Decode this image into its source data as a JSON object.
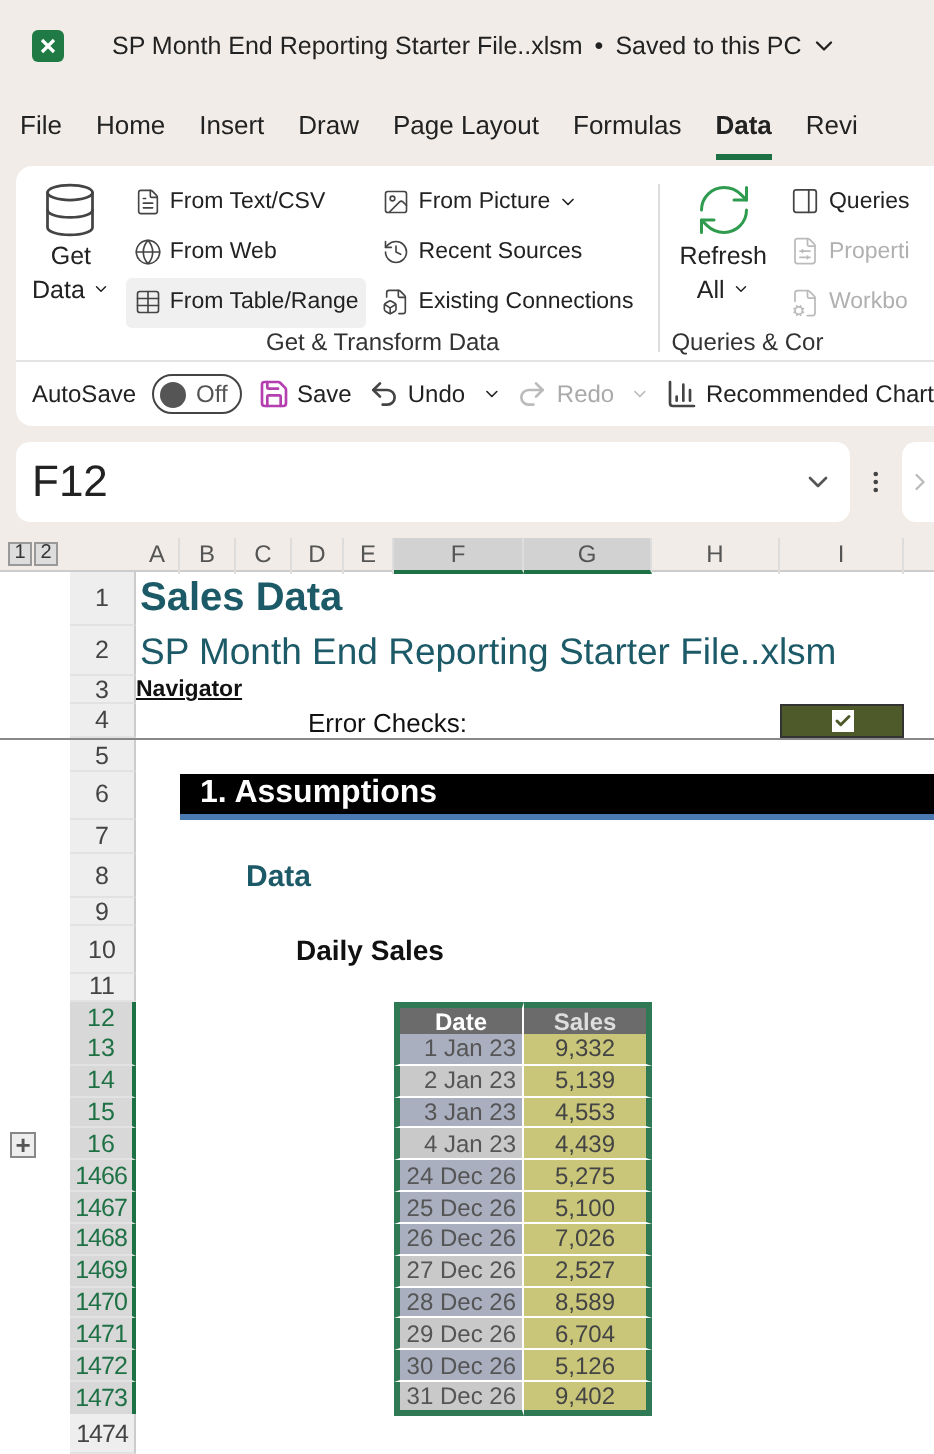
{
  "window": {
    "title": "SP Month End Reporting Starter File..xlsm",
    "separator": "•",
    "save_status": "Saved to this PC"
  },
  "tabs": [
    {
      "label": "File",
      "selected": false
    },
    {
      "label": "Home",
      "selected": false
    },
    {
      "label": "Insert",
      "selected": false
    },
    {
      "label": "Draw",
      "selected": false
    },
    {
      "label": "Page Layout",
      "selected": false
    },
    {
      "label": "Formulas",
      "selected": false
    },
    {
      "label": "Data",
      "selected": true
    },
    {
      "label": "Revi",
      "selected": false
    }
  ],
  "ribbon": {
    "get_transform": {
      "get_data": {
        "line1": "Get",
        "line2": "Data"
      },
      "items": [
        {
          "label": "From Text/CSV",
          "caret": false,
          "hovered": false
        },
        {
          "label": "From Web",
          "caret": false,
          "hovered": false
        },
        {
          "label": "From Table/Range",
          "caret": false,
          "hovered": true
        },
        {
          "label": "From Picture",
          "caret": true,
          "hovered": false
        },
        {
          "label": "Recent Sources",
          "caret": false,
          "hovered": false
        },
        {
          "label": "Existing Connections",
          "caret": false,
          "hovered": false
        }
      ],
      "group_label": "Get & Transform Data"
    },
    "queries": {
      "refresh": {
        "line1": "Refresh",
        "line2": "All"
      },
      "items": [
        {
          "label": "Queries",
          "disabled": false
        },
        {
          "label": "Properti",
          "disabled": true
        },
        {
          "label": "Workbo",
          "disabled": true
        }
      ],
      "group_label": "Queries & Cor"
    }
  },
  "quick_access": {
    "autosave_label": "AutoSave",
    "autosave_on": false,
    "autosave_state": "Off",
    "save": "Save",
    "undo": "Undo",
    "redo": "Redo",
    "redo_disabled": true,
    "recommended": "Recommended Chart"
  },
  "name_box": {
    "value": "F12"
  },
  "outline_levels": [
    "1",
    "2"
  ],
  "columns": [
    {
      "label": "A",
      "selected": false
    },
    {
      "label": "B",
      "selected": false
    },
    {
      "label": "C",
      "selected": false
    },
    {
      "label": "D",
      "selected": false
    },
    {
      "label": "E",
      "selected": false
    },
    {
      "label": "F",
      "selected": true
    },
    {
      "label": "G",
      "selected": true
    },
    {
      "label": "H",
      "selected": false
    },
    {
      "label": "I",
      "selected": false
    }
  ],
  "rows": [
    {
      "num": "1",
      "kind": "title",
      "text": "Sales Data",
      "selected": false
    },
    {
      "num": "2",
      "kind": "subtitle",
      "text": "SP Month End Reporting Starter File..xlsm",
      "selected": false
    },
    {
      "num": "3",
      "kind": "link",
      "text": "Navigator",
      "selected": false
    },
    {
      "num": "4",
      "kind": "check",
      "label": "Error Checks:",
      "checked": true,
      "selected": false
    },
    {
      "num": "5",
      "kind": "empty",
      "selected": false
    },
    {
      "num": "6",
      "kind": "section",
      "text": "1. Assumptions",
      "selected": false
    },
    {
      "num": "7",
      "kind": "empty",
      "selected": false
    },
    {
      "num": "8",
      "kind": "heading",
      "text": "Data",
      "selected": false
    },
    {
      "num": "9",
      "kind": "empty",
      "selected": false
    },
    {
      "num": "10",
      "kind": "subheading",
      "text": "Daily Sales",
      "selected": false
    },
    {
      "num": "11",
      "kind": "empty",
      "selected": false
    },
    {
      "num": "12",
      "kind": "table_header",
      "date": "Date",
      "sales": "Sales",
      "selected": true
    },
    {
      "num": "13",
      "kind": "table_row",
      "date": "1 Jan 23",
      "sales": "9,332",
      "color": "#a9afbf",
      "selected": true
    },
    {
      "num": "14",
      "kind": "table_row",
      "date": "2 Jan 23",
      "sales": "5,139",
      "color": "#c9c9c9",
      "selected": true
    },
    {
      "num": "15",
      "kind": "table_row",
      "date": "3 Jan 23",
      "sales": "4,553",
      "color": "#a9afbf",
      "selected": true
    },
    {
      "num": "16",
      "kind": "table_row",
      "date": "4 Jan 23",
      "sales": "4,439",
      "color": "#c9c9c9",
      "selected": true,
      "outline": "+"
    },
    {
      "num": "1466",
      "kind": "table_row",
      "date": "24 Dec 26",
      "sales": "5,275",
      "color": "#a9afbf",
      "selected": true
    },
    {
      "num": "1467",
      "kind": "table_row",
      "date": "25 Dec 26",
      "sales": "5,100",
      "color": "#a9afbf",
      "selected": true
    },
    {
      "num": "1468",
      "kind": "table_row",
      "date": "26 Dec 26",
      "sales": "7,026",
      "color": "#a9afbf",
      "selected": true
    },
    {
      "num": "1469",
      "kind": "table_row",
      "date": "27 Dec 26",
      "sales": "2,527",
      "color": "#c9c9c9",
      "selected": true
    },
    {
      "num": "1470",
      "kind": "table_row",
      "date": "28 Dec 26",
      "sales": "8,589",
      "color": "#a9afbf",
      "selected": true
    },
    {
      "num": "1471",
      "kind": "table_row",
      "date": "29 Dec 26",
      "sales": "6,704",
      "color": "#c9c9c9",
      "selected": true
    },
    {
      "num": "1472",
      "kind": "table_row",
      "date": "30 Dec 26",
      "sales": "5,126",
      "color": "#a9afbf",
      "selected": true
    },
    {
      "num": "1473",
      "kind": "table_row",
      "date": "31 Dec 26",
      "sales": "9,402",
      "color": "#c9c9c9",
      "selected": true
    },
    {
      "num": "1474",
      "kind": "empty",
      "selected": false
    }
  ]
}
